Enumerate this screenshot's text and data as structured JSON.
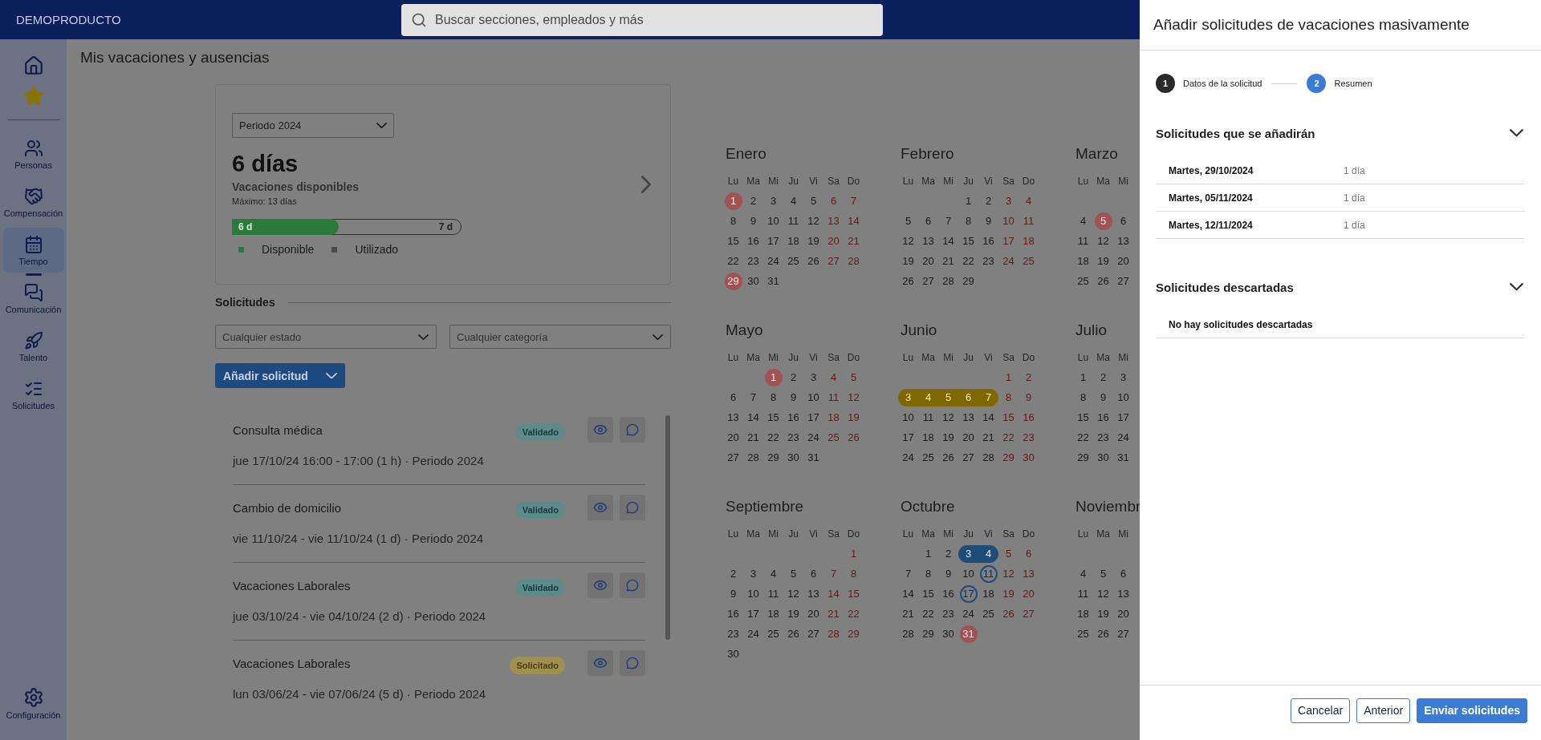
{
  "topbar": {
    "brand": "DEMOPRODUCTO",
    "search": {
      "placeholder": "Buscar secciones, empleados y más"
    }
  },
  "sidebar": {
    "items": [
      {
        "label": "Personas",
        "selected": false
      },
      {
        "label": "Compensación",
        "selected": false
      },
      {
        "label": "Tiempo",
        "selected": true
      },
      {
        "label": "Comunicación",
        "selected": false
      },
      {
        "label": "Talento",
        "selected": false
      },
      {
        "label": "Solicitudes",
        "selected": false
      }
    ],
    "footer_item": {
      "label": "Configuración"
    }
  },
  "page": {
    "title": "Mis vacaciones y ausencias"
  },
  "balance": {
    "period": "Periodo 2024",
    "days": "6 días",
    "subtitle": "Vacaciones disponibles",
    "maximum": "Máximo: 13 días",
    "bar": {
      "level": 0.47,
      "available": "6 d",
      "used": "7 d"
    },
    "legend": [
      {
        "label": "Disponible",
        "color": "#2a7a3a"
      },
      {
        "label": "Utilizado",
        "color": "#4a4a4a"
      }
    ]
  },
  "requests": {
    "heading": "Solicitudes",
    "filters": [
      {
        "placeholder": "Cualquier estado"
      },
      {
        "placeholder": "Cualquier categoría"
      }
    ],
    "add_button": "Añadir solicitud",
    "items": [
      {
        "title": "Consulta médica",
        "status": "Validado",
        "kind": "validated",
        "detail": "jue 17/10/24 16:00 - 17:00 (1 h) · Periodo 2024"
      },
      {
        "title": "Cambio de domicilio",
        "status": "Validado",
        "kind": "validated",
        "detail": "vie 11/10/24 - vie 11/10/24 (1 d) · Periodo 2024"
      },
      {
        "title": "Vacaciones Laborales",
        "status": "Validado",
        "kind": "validated",
        "detail": "jue 03/10/24 - vie 04/10/24 (2 d) · Periodo 2024"
      },
      {
        "title": "Vacaciones Laborales",
        "status": "Solicitado",
        "kind": "requested",
        "detail": "lun 03/06/24 - vie 07/06/24 (5 d) · Periodo 2024"
      }
    ]
  },
  "calendar": {
    "months": [
      {
        "name": "Enero",
        "weekdays": [
          "Lu",
          "Ma",
          "Mi",
          "Ju",
          "Vi",
          "Sa",
          "Do"
        ],
        "weeks": [
          [
            {
              "day": "1",
              "kind": "holiday"
            },
            "2",
            "3",
            "4",
            "5",
            "6",
            "7"
          ],
          [
            "8",
            "9",
            "10",
            "11",
            "12",
            "13",
            "14"
          ],
          [
            "15",
            "16",
            "17",
            "18",
            "19",
            "20",
            "21"
          ],
          [
            "22",
            "23",
            "24",
            "25",
            "26",
            "27",
            "28"
          ],
          [
            {
              "day": "29",
              "kind": "holiday"
            },
            "30",
            "31"
          ]
        ]
      },
      {
        "name": "Febrero",
        "weekdays": [
          "Lu",
          "Ma",
          "Mi",
          "Ju",
          "Vi",
          "Sa",
          "Do"
        ],
        "weeks": [
          [
            {
              "kind": "blank"
            },
            {
              "kind": "blank"
            },
            {
              "kind": "blank"
            },
            "1",
            "2",
            "3",
            "4"
          ],
          [
            "5",
            "6",
            "7",
            "8",
            "9",
            "10",
            "11"
          ],
          [
            "12",
            "13",
            "14",
            "15",
            "16",
            "17",
            "18"
          ],
          [
            "19",
            "20",
            "21",
            "22",
            "23",
            "24",
            "25"
          ],
          [
            "26",
            "27",
            "28",
            "29"
          ]
        ]
      },
      {
        "name": "Marzo",
        "weekdays": [
          "Lu",
          "Ma",
          "Mi"
        ],
        "weeks": [
          [
            {
              "kind": "blank"
            }
          ],
          [
            "4",
            {
              "day": "5",
              "kind": "holiday"
            },
            "6"
          ],
          [
            "11",
            "12",
            "13"
          ],
          [
            "18",
            "19",
            "20"
          ],
          [
            "25",
            "26",
            "27"
          ]
        ]
      },
      {
        "name": "Mayo",
        "weekdays": [
          "Lu",
          "Ma",
          "Mi",
          "Ju",
          "Vi",
          "Sa",
          "Do"
        ],
        "weeks": [
          [
            {
              "kind": "blank"
            },
            {
              "kind": "blank"
            },
            {
              "day": "1",
              "kind": "holiday"
            },
            "2",
            "3",
            "4",
            "5"
          ],
          [
            "6",
            "7",
            "8",
            "9",
            "10",
            "11",
            "12"
          ],
          [
            "13",
            "14",
            "15",
            "16",
            "17",
            "18",
            "19"
          ],
          [
            "20",
            "21",
            "22",
            "23",
            "24",
            "25",
            "26"
          ],
          [
            "27",
            "28",
            "29",
            "30",
            "31"
          ]
        ]
      },
      {
        "name": "Junio",
        "weekdays": [
          "Lu",
          "Ma",
          "Mi",
          "Ju",
          "Vi",
          "Sa",
          "Do"
        ],
        "weeks": [
          [
            {
              "kind": "blank"
            },
            {
              "kind": "blank"
            },
            {
              "kind": "blank"
            },
            {
              "kind": "blank"
            },
            {
              "kind": "blank"
            },
            "1",
            "2"
          ],
          [
            {
              "day": "3",
              "kind": "pending"
            },
            {
              "day": "4",
              "kind": "pending"
            },
            {
              "day": "5",
              "kind": "pending"
            },
            {
              "day": "6",
              "kind": "pending"
            },
            {
              "day": "7",
              "kind": "pending"
            },
            "8",
            "9"
          ],
          [
            "10",
            "11",
            "12",
            "13",
            "14",
            "15",
            "16"
          ],
          [
            "17",
            "18",
            "19",
            "20",
            "21",
            "22",
            "23"
          ],
          [
            "24",
            "25",
            "26",
            "27",
            "28",
            "29",
            "30"
          ]
        ]
      },
      {
        "name": "Julio",
        "weekdays": [
          "Lu",
          "Ma",
          "Mi"
        ],
        "weeks": [
          [
            "1",
            "2",
            "3"
          ],
          [
            "8",
            "9",
            "10"
          ],
          [
            "15",
            "16",
            "17"
          ],
          [
            "22",
            "23",
            "24"
          ],
          [
            "29",
            "30",
            "31"
          ]
        ]
      },
      {
        "name": "Septiembre",
        "weekdays": [
          "Lu",
          "Ma",
          "Mi",
          "Ju",
          "Vi",
          "Sa",
          "Do"
        ],
        "weeks": [
          [
            {
              "kind": "blank"
            },
            {
              "kind": "blank"
            },
            {
              "kind": "blank"
            },
            {
              "kind": "blank"
            },
            {
              "kind": "blank"
            },
            {
              "kind": "blank"
            },
            "1"
          ],
          [
            "2",
            "3",
            "4",
            "5",
            "6",
            "7",
            "8"
          ],
          [
            "9",
            "10",
            "11",
            "12",
            "13",
            "14",
            "15"
          ],
          [
            "16",
            "17",
            "18",
            "19",
            "20",
            "21",
            "22"
          ],
          [
            "23",
            "24",
            "25",
            "26",
            "27",
            "28",
            "29"
          ],
          [
            "30"
          ]
        ]
      },
      {
        "name": "Octubre",
        "weekdays": [
          "Lu",
          "Ma",
          "Mi",
          "Ju",
          "Vi",
          "Sa",
          "Do"
        ],
        "weeks": [
          [
            {
              "kind": "blank"
            },
            "1",
            "2",
            {
              "day": "3",
              "kind": "approved"
            },
            {
              "day": "4",
              "kind": "approved"
            },
            "5",
            "6"
          ],
          [
            "7",
            "8",
            "9",
            "10",
            {
              "day": "11",
              "kind": "requested"
            },
            "12",
            "13"
          ],
          [
            "14",
            "15",
            "16",
            {
              "day": "17",
              "kind": "requested"
            },
            "18",
            "19",
            "20"
          ],
          [
            "21",
            "22",
            "23",
            "24",
            "25",
            "26",
            "27"
          ],
          [
            "28",
            "29",
            "30",
            {
              "day": "31",
              "kind": "holiday"
            }
          ]
        ]
      },
      {
        "name": "Noviembr",
        "weekdays": [
          "Lu",
          "Ma",
          "Mi"
        ],
        "weeks": [
          [
            {
              "kind": "blank"
            }
          ],
          [
            "4",
            "5",
            "6"
          ],
          [
            "11",
            "12",
            "13"
          ],
          [
            "18",
            "19",
            "20"
          ],
          [
            "25",
            "26",
            "27"
          ]
        ]
      }
    ]
  },
  "dialog": {
    "title": "Añadir solicitudes de vacaciones masivamente",
    "steps": [
      {
        "number": "1",
        "label": "Datos de la solicitud",
        "selected": false
      },
      {
        "number": "2",
        "label": "Resumen",
        "selected": true
      }
    ],
    "sections": [
      {
        "title": "Solicitudes que se añadirán",
        "expanded": true,
        "rows": [
          {
            "date": "Martes, 29/10/2024",
            "duration": "1 día"
          },
          {
            "date": "Martes, 05/11/2024",
            "duration": "1 día"
          },
          {
            "date": "Martes, 12/11/2024",
            "duration": "1 día"
          }
        ]
      },
      {
        "title": "Solicitudes descartadas",
        "expanded": true,
        "empty_text": "No hay solicitudes descartadas"
      }
    ],
    "buttons": [
      {
        "label": "Cancelar",
        "kind": "secondary"
      },
      {
        "label": "Anterior",
        "kind": "secondary"
      },
      {
        "label": "Enviar solicitudes",
        "kind": "primary"
      }
    ]
  }
}
